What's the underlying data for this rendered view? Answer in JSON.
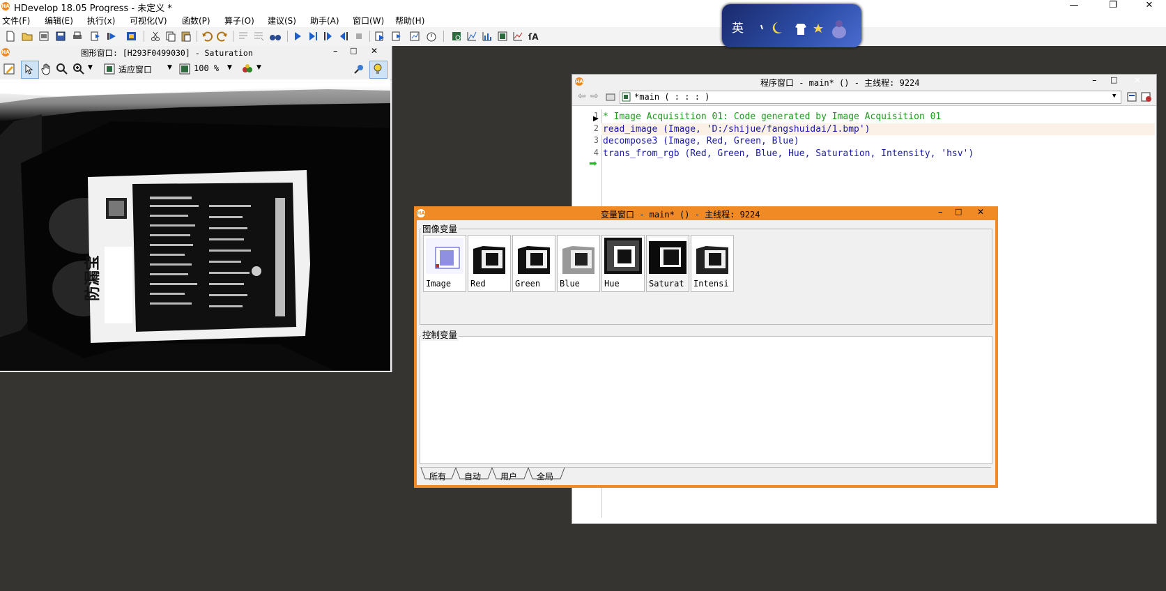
{
  "app": {
    "title": "HDevelop 18.05 Progress - 未定义 *",
    "window_controls": {
      "minimize": "—",
      "restore": "❐",
      "close": "✕"
    }
  },
  "menu": [
    "文件(F)",
    "编辑(E)",
    "执行(x)",
    "可视化(V)",
    "函数(P)",
    "算子(O)",
    "建议(S)",
    "助手(A)",
    "窗口(W)",
    "帮助(H)"
  ],
  "ime_badge": {
    "char": "英"
  },
  "graphics_window": {
    "title": "图形窗口: [H293F0499030] - Saturation",
    "fit_label": "适应窗口",
    "zoom": "100 %"
  },
  "program_window": {
    "title": "程序窗口 - main* () - 主线程: 9224",
    "procedure": "*main ( : : : )",
    "lines": [
      {
        "num": "1",
        "text": "* Image Acquisition 01: Code generated by Image Acquisition 01",
        "color": "#1d9b1d"
      },
      {
        "num": "2",
        "text": "read_image (Image, 'D:/shijue/fangshuidai/1.bmp')",
        "color": "#1a1aa6"
      },
      {
        "num": "3",
        "text": "decompose3 (Image, Red, Green, Blue)",
        "color": "#1a1aa6"
      },
      {
        "num": "4",
        "text": "trans_from_rgb (Red, Green, Blue, Hue, Saturation, Intensity, 'hsv')",
        "color": "#1a1aa6"
      }
    ]
  },
  "variable_window": {
    "title": "变量窗口 - main* () - 主线程: 9224",
    "image_vars_label": "图像变量",
    "control_vars_label": "控制变量",
    "image_vars": [
      "Image",
      "Red",
      "Green",
      "Blue",
      "Hue",
      "Saturat",
      "Intensi"
    ],
    "tabs": [
      "所有",
      "自动",
      "用户",
      "全局"
    ]
  },
  "colors": {
    "accent": "#f08a24",
    "desktop": "#353431"
  }
}
